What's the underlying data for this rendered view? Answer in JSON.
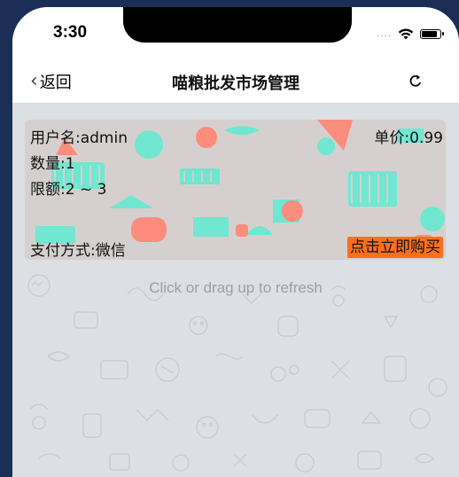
{
  "status_bar": {
    "time": "3:30",
    "signal": "....",
    "wifi_icon": "wifi-icon",
    "battery_icon": "battery-icon"
  },
  "nav": {
    "back_label": "返回",
    "title": "喵粮批发市场管理",
    "refresh_icon": "refresh-icon"
  },
  "card": {
    "username": "用户名:admin",
    "price": "单价:0.99",
    "quantity": "数量:1",
    "limit": "限额:2 ~ 3",
    "payment": "支付方式:微信",
    "buy_label": "点击立即购买",
    "colors": {
      "mint": "#71e6d0",
      "salmon": "#fc8c7c",
      "card_bg": "#d5d0cf",
      "buy_button": "#fb6f1d"
    }
  },
  "pull_hint": "Click or drag up to refresh"
}
